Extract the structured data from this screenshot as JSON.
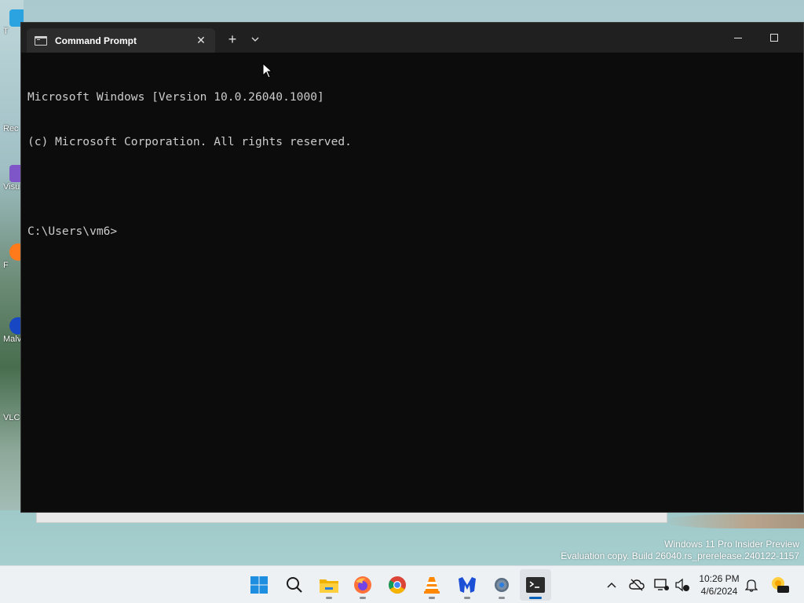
{
  "window": {
    "tab_title": "Command Prompt",
    "tab_close": "✕",
    "new_tab": "+"
  },
  "console": {
    "lines": [
      "Microsoft Windows [Version 10.0.26040.1000]",
      "(c) Microsoft Corporation. All rights reserved.",
      "",
      "C:\\Users\\vm6>"
    ]
  },
  "desktop": {
    "icons": [
      {
        "label": "T"
      },
      {
        "label": "Rec"
      },
      {
        "label": "Visu"
      },
      {
        "label": "F"
      },
      {
        "label": "Malv"
      },
      {
        "label": "VLC"
      }
    ]
  },
  "watermark": {
    "line1": "Windows 11 Pro Insider Preview",
    "line2": "Evaluation copy. Build 26040.rs_prerelease.240122-1157"
  },
  "taskbar": {
    "time": "10:26 PM",
    "date": "4/6/2024",
    "apps": [
      "windows-start-icon",
      "search-icon",
      "file-explorer-icon",
      "firefox-icon",
      "chrome-icon",
      "vlc-icon",
      "malwarebytes-icon",
      "settings-icon",
      "terminal-icon"
    ]
  }
}
